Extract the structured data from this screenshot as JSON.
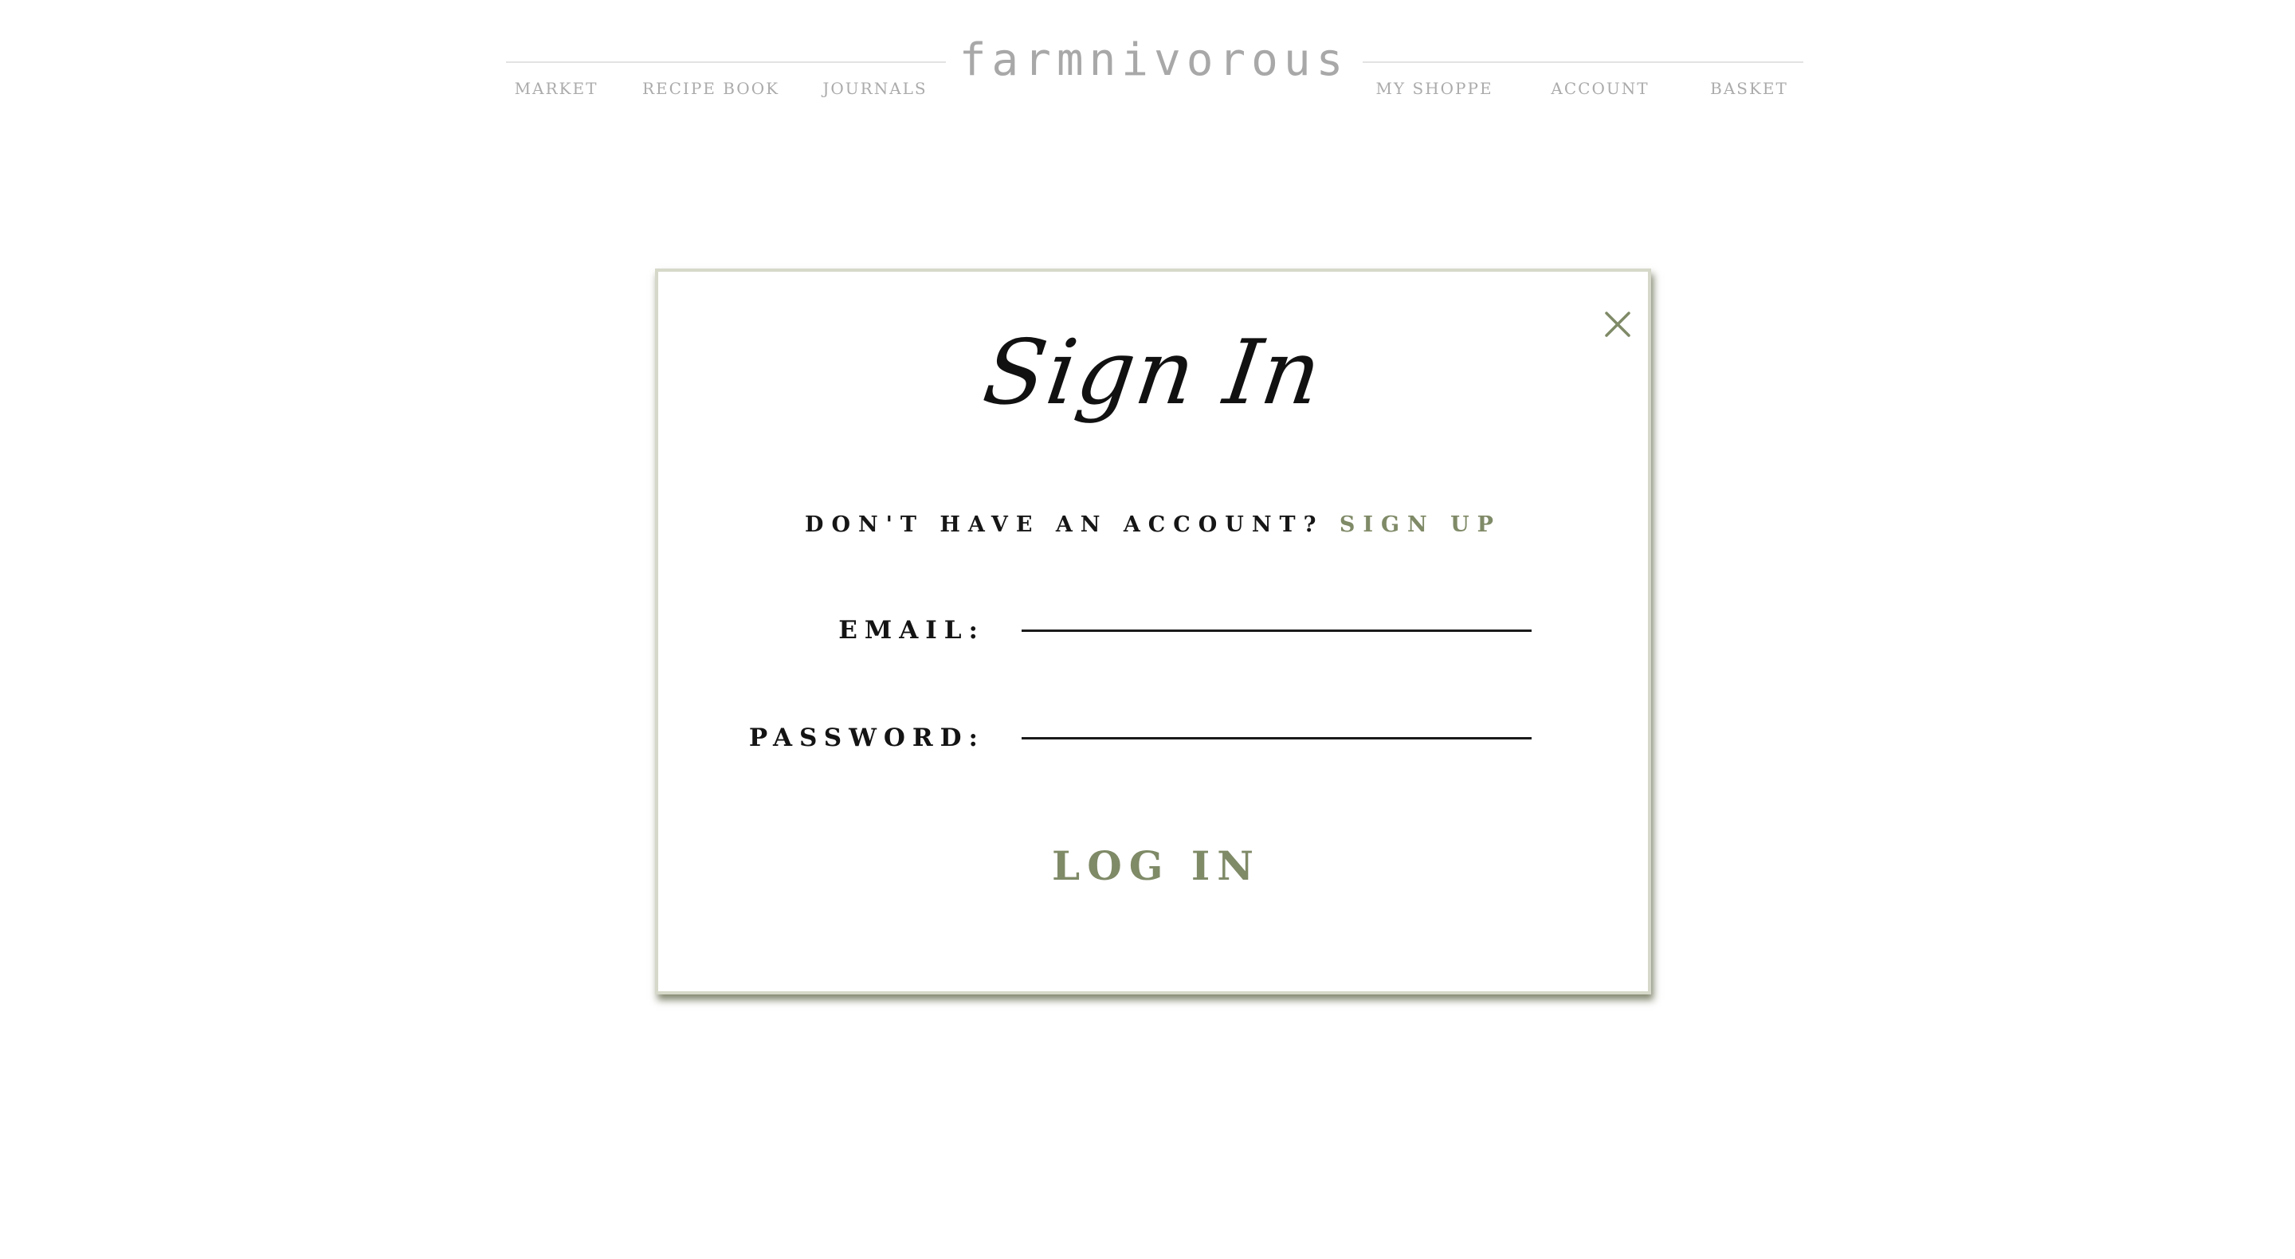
{
  "header": {
    "logo": "farmnivorous",
    "nav_left": [
      {
        "label": "MARKET"
      },
      {
        "label": "RECIPE BOOK"
      },
      {
        "label": "JOURNALS"
      }
    ],
    "nav_right": [
      {
        "label": "MY SHOPPE"
      },
      {
        "label": "ACCOUNT"
      },
      {
        "label": "BASKET"
      }
    ]
  },
  "modal": {
    "title": "Sign In",
    "close_icon": "close-icon",
    "signup_prompt": "DON'T HAVE AN ACCOUNT? ",
    "signup_link": "SIGN UP",
    "email_label": "EMAIL:",
    "email_value": "",
    "password_label": "PASSWORD:",
    "password_value": "",
    "login_label": "LOG IN"
  },
  "colors": {
    "accent": "#7f8a67",
    "nav_text": "#ababab",
    "modal_border": "#d6d8c9"
  }
}
